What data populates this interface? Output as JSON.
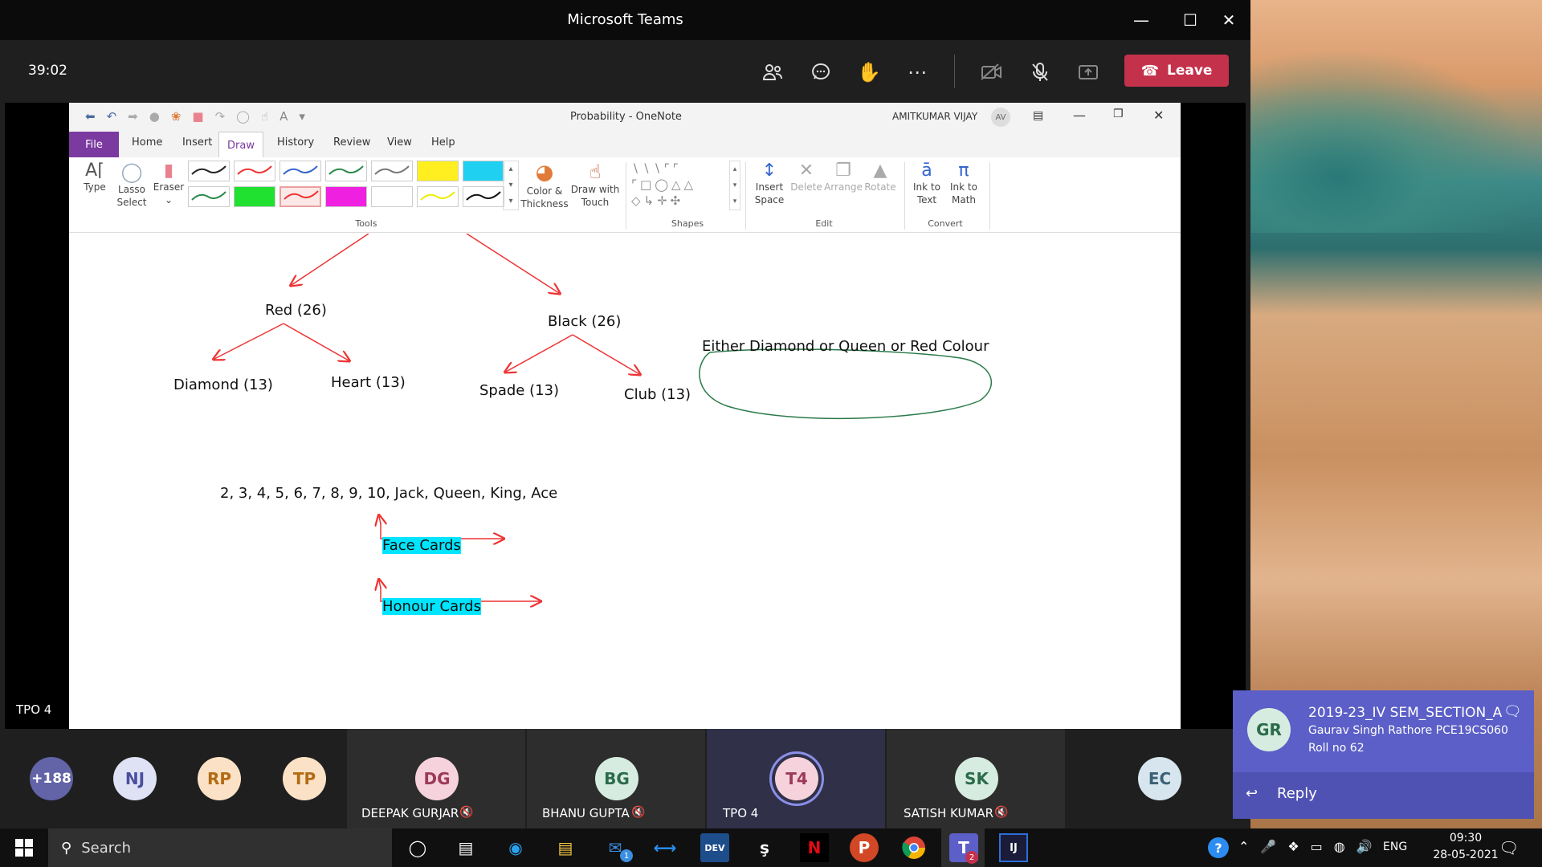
{
  "window": {
    "title": "Microsoft Teams"
  },
  "meeting": {
    "timer": "39:02",
    "leave_label": "Leave"
  },
  "onenote": {
    "title": "Probability  -  OneNote",
    "user_name": "AMITKUMAR VIJAY",
    "user_initials": "AV",
    "tabs": [
      "File",
      "Home",
      "Insert",
      "Draw",
      "History",
      "Review",
      "View",
      "Help"
    ],
    "tools": {
      "type": "Type",
      "lasso1": "Lasso",
      "lasso2": "Select",
      "eraser": "Eraser",
      "color1": "Color &",
      "color2": "Thickness",
      "touch1": "Draw with",
      "touch2": "Touch",
      "group_tools": "Tools",
      "group_shapes": "Shapes",
      "insert1": "Insert",
      "insert2": "Space",
      "delete": "Delete",
      "arrange": "Arrange",
      "rotate": "Rotate",
      "group_edit": "Edit",
      "ink_text1": "Ink to",
      "ink_text2": "Text",
      "ink_math1": "Ink to",
      "ink_math2": "Math",
      "group_convert": "Convert"
    },
    "canvas": {
      "red": "Red (26)",
      "black": "Black (26)",
      "diamond": "Diamond (13)",
      "heart": "Heart (13)",
      "spade": "Spade (13)",
      "club": "Club (13)",
      "either": "Either Diamond or Queen or Red Colour",
      "sequence": "2, 3, 4, 5, 6, 7, 8, 9, 10, Jack, Queen, King, Ace",
      "face": "Face Cards",
      "honour": "Honour Cards"
    }
  },
  "presenter_label": "TPO 4",
  "participants": [
    {
      "initials": "+188",
      "color": "#6264a7",
      "text": "#fff"
    },
    {
      "initials": "NJ",
      "color": "#dfe1f5",
      "text": "#4a4f9e"
    },
    {
      "initials": "RP",
      "color": "#fbe2c6",
      "text": "#b36b14"
    },
    {
      "initials": "TP",
      "color": "#fbe2c6",
      "text": "#b36b14"
    },
    {
      "initials": "DG",
      "color": "#f6d2dc",
      "text": "#9b3a5a",
      "name": "DEEPAK GURJAR"
    },
    {
      "initials": "BG",
      "color": "#d6ece0",
      "text": "#2b6b4a",
      "name": "BHANU GUPTA"
    },
    {
      "initials": "T4",
      "color": "#f6d2dc",
      "text": "#9b3a5a",
      "name": "TPO 4"
    },
    {
      "initials": "SK",
      "color": "#d6ece0",
      "text": "#2b6b4a",
      "name": "SATISH KUMAR"
    },
    {
      "initials": "EC",
      "color": "#d7e6ee",
      "text": "#3a6174"
    }
  ],
  "notification": {
    "initials": "GR",
    "channel": "2019-23_IV SEM_SECTION_A",
    "line1": "Gaurav Singh Rathore PCE19CS060",
    "line2": "Roll no 62",
    "reply": "Reply"
  },
  "taskbar": {
    "search": "Search",
    "mail_badge": "1",
    "teams_badge": "2",
    "lang": "ENG",
    "time": "09:30",
    "date": "28-05-2021"
  }
}
